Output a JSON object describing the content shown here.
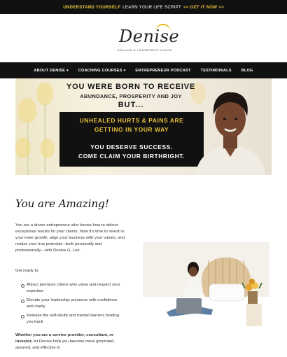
{
  "topbar": {
    "highlight": "UNDERSTAND YOURSELF",
    "middle": "LEARN YOUR LIFE SCRIPT",
    "cta": "<< GET IT NOW >>"
  },
  "logo": {
    "name": "Denise",
    "tagline": "HEALING & LEADERSHIP COACH"
  },
  "nav": {
    "items": [
      {
        "label": "ABOUT DENISE",
        "dropdown": true
      },
      {
        "label": "COACHING COURSES",
        "dropdown": true
      },
      {
        "label": "ENTREPRENEUR PODCAST",
        "dropdown": false
      },
      {
        "label": "TESTIMONIALS",
        "dropdown": false
      },
      {
        "label": "BLOG",
        "dropdown": false
      }
    ],
    "chevron": "▾"
  },
  "hero": {
    "line1": "YOU WERE BORN TO RECEIVE",
    "line2": "ABUNDANCE, PROSPERITY AND JOY",
    "line3": "BUT...",
    "box_line1": "UNHEALED HURTS & PAINS ARE",
    "box_line2": "GETTING IN YOUR WAY",
    "box_line3": "YOU DESERVE SUCCESS.",
    "box_line4": "COME CLAIM YOUR BIRTHRIGHT."
  },
  "intro": {
    "title": "You are Amazing!",
    "para": "You are a driven entrepreneur who knows how to deliver exceptional results for your clients. Now it's time to invest in your inner growth, align your business with your values, and realize your true potential—both personally and professionally—with Denise G. Lee.",
    "ready": "Get ready to:",
    "bullets": [
      "Attract premium clients who value and respect your expertise",
      "Elevate your leadership presence with confidence and clarity",
      "Release the self-doubt and mental barriers holding you back"
    ],
    "closing_bold": "Whether you are a service provider, consultant, or investor,",
    "closing_rest": "let Denise help you become more grounded, assured, and effective in"
  },
  "colors": {
    "black": "#111111",
    "gold": "#e9c13a",
    "cream": "#f4efe0"
  }
}
